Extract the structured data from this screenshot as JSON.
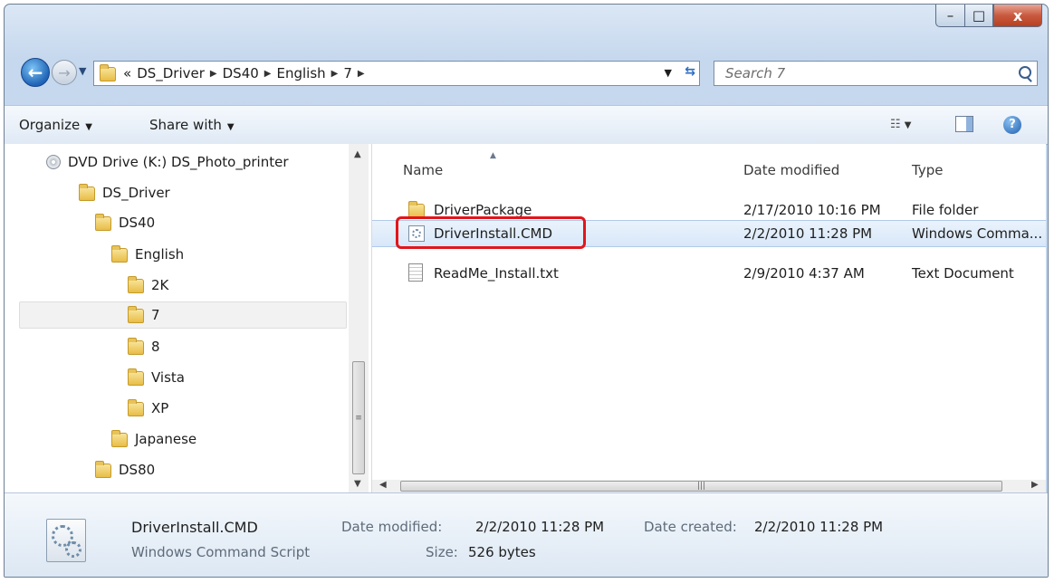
{
  "window": {
    "buttons": {
      "minimize": "–",
      "maximize": "□",
      "close": "x"
    }
  },
  "nav": {
    "back": "←",
    "forward": "→",
    "overflow": "«",
    "breadcrumbs": [
      "DS_Driver",
      "DS40",
      "English",
      "7"
    ],
    "search_placeholder": "Search 7"
  },
  "toolbar": {
    "organize": "Organize",
    "share_with": "Share with"
  },
  "tree": [
    {
      "label": "DVD Drive (K:) DS_Photo_printer",
      "icon": "dvd-drive-icon"
    },
    {
      "label": "DS_Driver",
      "icon": "folder-icon"
    },
    {
      "label": "DS40",
      "icon": "folder-icon"
    },
    {
      "label": "English",
      "icon": "folder-icon"
    },
    {
      "label": "2K",
      "icon": "folder-icon"
    },
    {
      "label": "7",
      "icon": "folder-icon",
      "selected": true
    },
    {
      "label": "8",
      "icon": "folder-icon"
    },
    {
      "label": "Vista",
      "icon": "folder-icon"
    },
    {
      "label": "XP",
      "icon": "folder-icon"
    },
    {
      "label": "Japanese",
      "icon": "folder-icon"
    },
    {
      "label": "DS80",
      "icon": "folder-icon"
    }
  ],
  "columns": {
    "name": "Name",
    "date": "Date modified",
    "type": "Type"
  },
  "files": [
    {
      "name": "DriverPackage",
      "date": "2/17/2010 10:16 PM",
      "type": "File folder",
      "icon": "folder-icon"
    },
    {
      "name": "DriverInstall.CMD",
      "date": "2/2/2010 11:28 PM",
      "type": "Windows Comma...",
      "icon": "cmd-script-icon",
      "selected": true
    },
    {
      "name": "ReadMe_Install.txt",
      "date": "2/9/2010 4:37 AM",
      "type": "Text Document",
      "icon": "text-file-icon"
    }
  ],
  "details": {
    "name": "DriverInstall.CMD",
    "type": "Windows Command Script",
    "date_modified_label": "Date modified:",
    "date_modified": "2/2/2010 11:28 PM",
    "size_label": "Size:",
    "size": "526 bytes",
    "date_created_label": "Date created:",
    "date_created": "2/2/2010 11:28 PM"
  },
  "colors": {
    "highlight": "#e3151a",
    "selection": "#d8e7f9"
  }
}
